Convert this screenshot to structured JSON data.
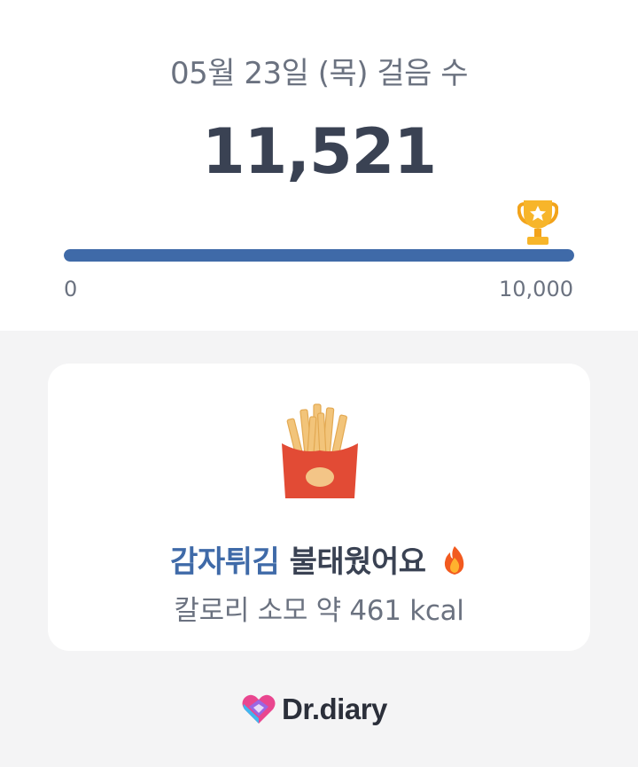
{
  "header": {
    "date_title": "05월 23일 (목) 걸음 수",
    "step_count": "11,521"
  },
  "progress": {
    "min_label": "0",
    "max_label": "10,000",
    "value": 11521,
    "goal": 10000,
    "fill_fraction": 1.0,
    "goal_icon": "trophy-icon",
    "fill_color": "#3f6aa8"
  },
  "burn_card": {
    "food_icon": "french-fries-icon",
    "food_name": "감자튀김",
    "burned_text": "불태웠어요",
    "emoji_icon": "fire-icon",
    "calorie_text": "칼로리 소모 약 461 kcal",
    "accent_color": "#3f6aa8"
  },
  "brand": {
    "logo_icon": "heart-logo-icon",
    "name": "Dr.diary"
  }
}
